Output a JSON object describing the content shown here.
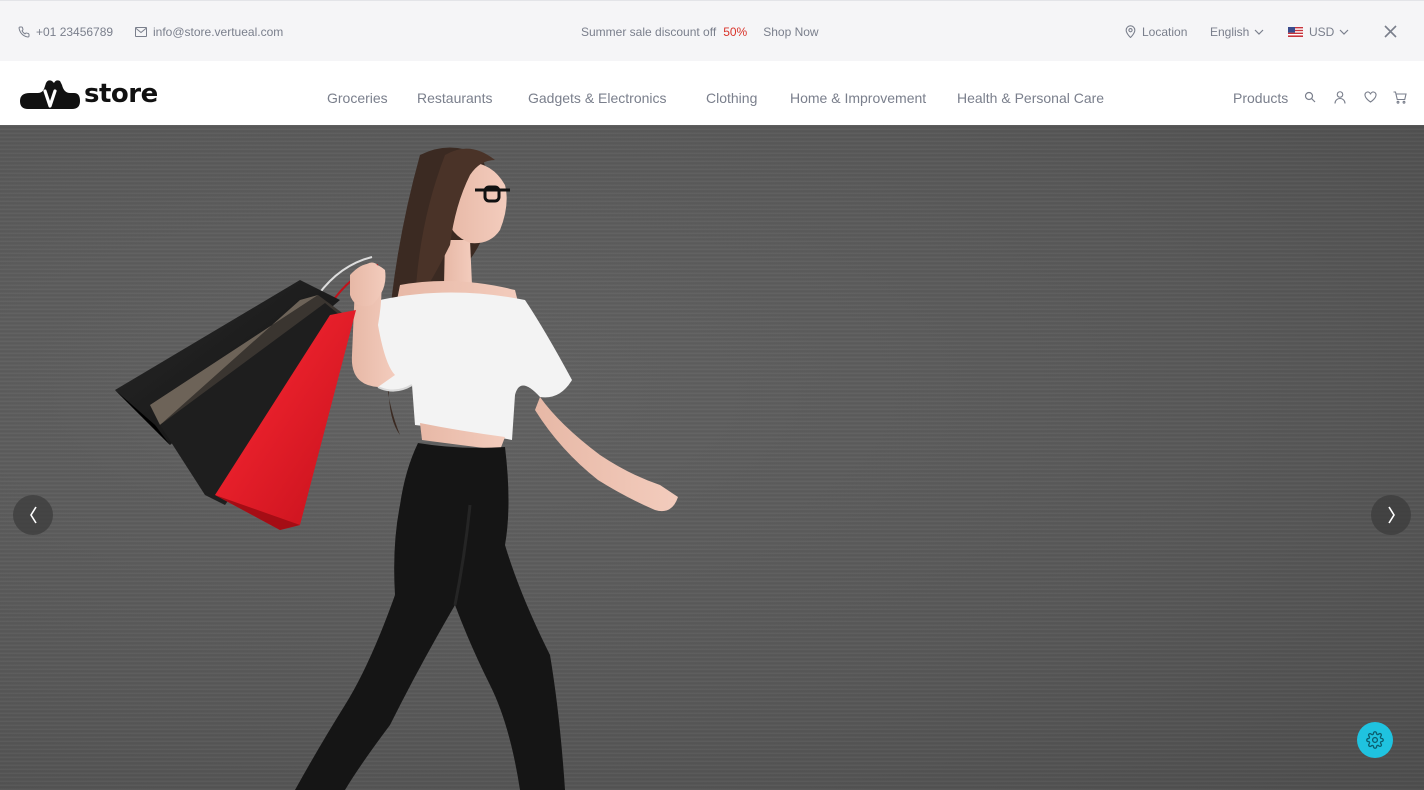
{
  "topbar": {
    "phone": "+01 23456789",
    "email": "info@store.vertueal.com",
    "promo_text": "Summer sale discount off",
    "promo_percent": "50%",
    "shop_now": "Shop Now",
    "location": "Location",
    "language": "English",
    "currency": "USD"
  },
  "header": {
    "logo_text": "store",
    "nav": [
      "Groceries",
      "Restaurants",
      "Gadgets & Electronics",
      "Clothing",
      "Home & Improvement",
      "Health & Personal Care"
    ],
    "products_label": "Products"
  },
  "colors": {
    "accent": "#1fc3e0",
    "promo_red": "#d9342b",
    "text_muted": "#7a7f8c",
    "topbar_bg": "#f5f5f7",
    "hero_bg": "#5b5b5b"
  },
  "icons": [
    "phone-icon",
    "mail-icon",
    "location-pin-icon",
    "chevron-down-icon",
    "us-flag-icon",
    "close-icon",
    "search-icon",
    "user-icon",
    "heart-icon",
    "cart-icon",
    "chevron-left-icon",
    "chevron-right-icon",
    "gear-icon"
  ]
}
